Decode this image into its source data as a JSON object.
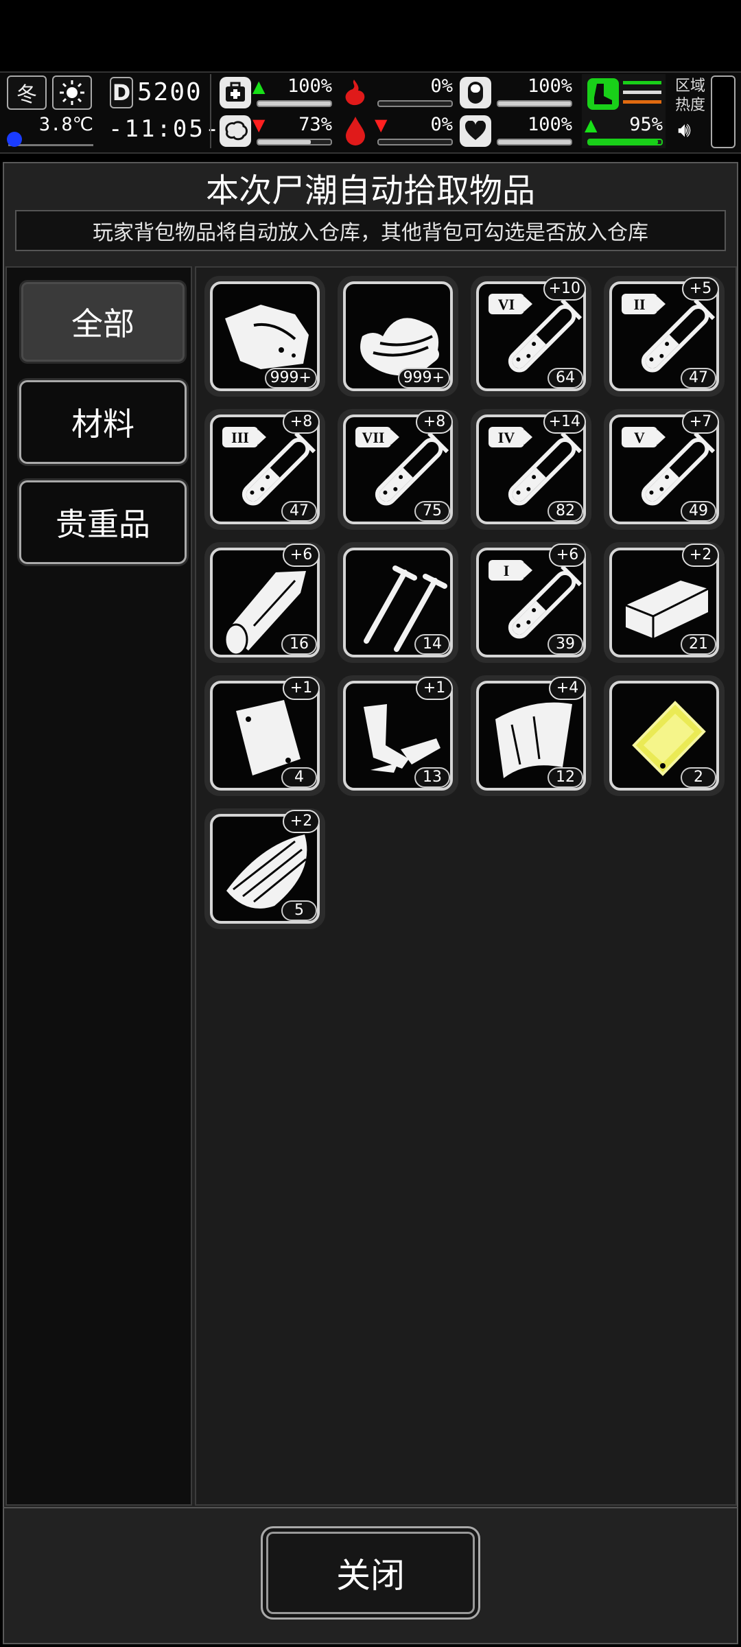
{
  "hud": {
    "season": "冬",
    "temperature": "3.8℃",
    "day_prefix": "D",
    "day": "5200",
    "time": "-11:05-",
    "stats": [
      {
        "icon": "medkit-icon",
        "value": "100%",
        "trend": "up",
        "level": 1.0
      },
      {
        "icon": "stomach-icon",
        "value": "0%",
        "trend": "none",
        "level": 0.0
      },
      {
        "icon": "pill-icon",
        "value": "100%",
        "trend": "none",
        "level": 1.0
      },
      {
        "icon": "brain-icon",
        "value": "73%",
        "trend": "down",
        "level": 0.73
      },
      {
        "icon": "blood-drop-icon",
        "value": "0%",
        "trend": "down",
        "level": 0.0
      },
      {
        "icon": "heart-icon",
        "value": "100%",
        "trend": "none",
        "level": 1.0
      }
    ],
    "stamina": {
      "value": "95%",
      "level": 0.95,
      "trend": "up"
    },
    "area_heat_label": "区域热度",
    "colors": {
      "green": "#19d019",
      "orange": "#e06a10",
      "red": "#e01a1a"
    }
  },
  "dialog": {
    "title": "本次尸潮自动拾取物品",
    "subtitle": "玩家背包物品将自动放入仓库，其他背包可勾选是否放入仓库",
    "tabs": [
      {
        "label": "全部",
        "active": true
      },
      {
        "label": "材料",
        "active": false
      },
      {
        "label": "贵重品",
        "active": false
      }
    ],
    "items": [
      {
        "icon": "meat-wrap-icon",
        "count": "999+",
        "badge": ""
      },
      {
        "icon": "cloth-stack-icon",
        "count": "999+",
        "badge": ""
      },
      {
        "icon": "test-tube-vi-icon",
        "tier": "VI",
        "count": "64",
        "badge": "+10"
      },
      {
        "icon": "test-tube-ii-icon",
        "tier": "II",
        "count": "47",
        "badge": "+5"
      },
      {
        "icon": "test-tube-iii-icon",
        "tier": "III",
        "count": "47",
        "badge": "+8"
      },
      {
        "icon": "test-tube-vii-icon",
        "tier": "VII",
        "count": "75",
        "badge": "+8"
      },
      {
        "icon": "test-tube-iv-icon",
        "tier": "IV",
        "count": "82",
        "badge": "+14"
      },
      {
        "icon": "test-tube-v-icon",
        "tier": "V",
        "count": "49",
        "badge": "+7"
      },
      {
        "icon": "wood-log-icon",
        "count": "16",
        "badge": "+6"
      },
      {
        "icon": "nails-icon",
        "count": "14",
        "badge": ""
      },
      {
        "icon": "test-tube-i-icon",
        "tier": "I",
        "count": "39",
        "badge": "+6"
      },
      {
        "icon": "brick-icon",
        "count": "21",
        "badge": "+2"
      },
      {
        "icon": "metal-plate-icon",
        "count": "4",
        "badge": "+1"
      },
      {
        "icon": "scrap-parts-icon",
        "count": "13",
        "badge": "+1"
      },
      {
        "icon": "fabric-sheet-icon",
        "count": "12",
        "badge": "+4"
      },
      {
        "icon": "gold-plate-icon",
        "count": "2",
        "badge": ""
      },
      {
        "icon": "plank-bundle-icon",
        "count": "5",
        "badge": "+2"
      }
    ],
    "close_label": "关闭"
  }
}
